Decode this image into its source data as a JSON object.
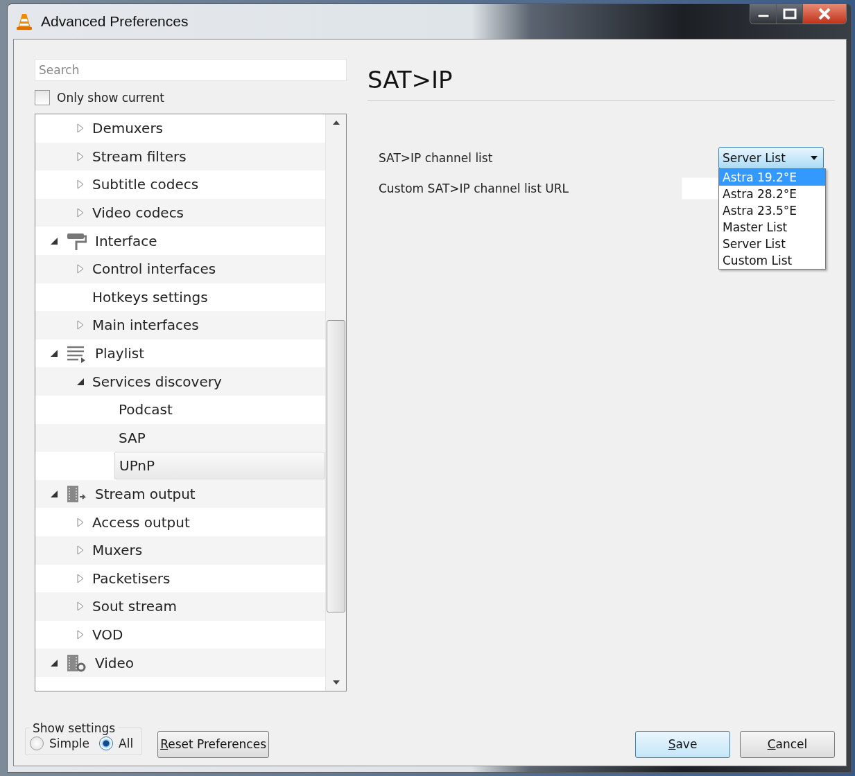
{
  "window": {
    "title": "Advanced Preferences"
  },
  "search": {
    "placeholder": "Search"
  },
  "only_show_current": {
    "label": "Only show current",
    "checked": false
  },
  "tree": [
    {
      "children": [
        {
          "label": "Demuxers",
          "expanded": false,
          "selected": false
        },
        {
          "label": "Stream filters",
          "expanded": false,
          "selected": false
        },
        {
          "label": "Subtitle codecs",
          "expanded": false,
          "selected": false
        },
        {
          "label": "Video codecs",
          "expanded": false,
          "selected": false
        }
      ]
    },
    {
      "label": "Interface",
      "kind": "interface",
      "expanded": true,
      "selected": false,
      "children": [
        {
          "label": "Control interfaces",
          "expanded": false,
          "selected": false
        },
        {
          "label": "Hotkeys settings",
          "selected": false
        },
        {
          "label": "Main interfaces",
          "expanded": false,
          "selected": false
        }
      ]
    },
    {
      "label": "Playlist",
      "kind": "playlist",
      "expanded": true,
      "selected": false,
      "children": [
        {
          "label": "Services discovery",
          "expanded": true,
          "selected": false,
          "children": [
            {
              "label": "Podcast",
              "selected": false
            },
            {
              "label": "SAP",
              "selected": false
            },
            {
              "label": "UPnP",
              "selected": true
            }
          ]
        }
      ]
    },
    {
      "label": "Stream output",
      "kind": "stream-output",
      "expanded": true,
      "selected": false,
      "children": [
        {
          "label": "Access output",
          "expanded": false,
          "selected": false
        },
        {
          "label": "Muxers",
          "expanded": false,
          "selected": false
        },
        {
          "label": "Packetisers",
          "expanded": false,
          "selected": false
        },
        {
          "label": "Sout stream",
          "expanded": false,
          "selected": false
        },
        {
          "label": "VOD",
          "expanded": false,
          "selected": false
        }
      ]
    },
    {
      "label": "Video",
      "kind": "video",
      "expanded": true,
      "selected": false
    }
  ],
  "panel": {
    "title": "SAT>IP",
    "options": [
      {
        "label": "SAT>IP channel list",
        "kind": "dropdown",
        "value": "Server List",
        "expanded": true,
        "choices": [
          {
            "label": "Astra 19.2°E",
            "highlighted": true
          },
          {
            "label": "Astra 28.2°E",
            "highlighted": false
          },
          {
            "label": "Astra 23.5°E",
            "highlighted": false
          },
          {
            "label": "Master List",
            "highlighted": false
          },
          {
            "label": "Server List",
            "highlighted": false
          },
          {
            "label": "Custom List",
            "highlighted": false
          }
        ]
      },
      {
        "label": "Custom SAT>IP channel list URL",
        "kind": "text"
      }
    ]
  },
  "show_settings": {
    "title": "Show settings",
    "modes": [
      {
        "label": "Simple",
        "selected": false
      },
      {
        "label": "All",
        "selected": true
      }
    ]
  },
  "reset_button": {
    "label": "Reset Preferences"
  },
  "dialog_buttons": [
    {
      "label": "Save",
      "default": true
    },
    {
      "label": "Cancel",
      "default": false
    }
  ]
}
